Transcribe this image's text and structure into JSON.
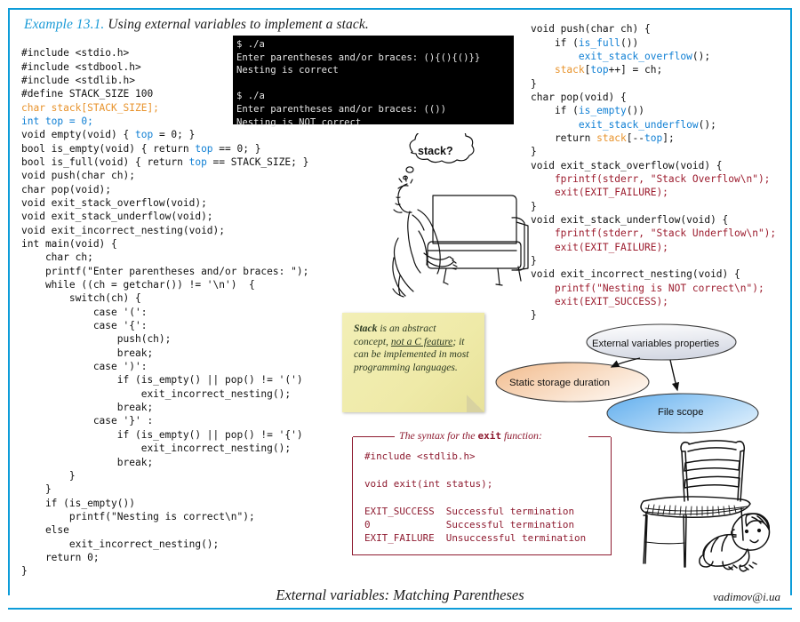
{
  "theme": {
    "frame_color": "#0d9cd9",
    "accent_blue": "#1b9bd7",
    "code_blue": "#0f7fd4",
    "code_orange": "#e8932c",
    "code_red": "#8e1b30",
    "sticky_yellow": "#efeaa8",
    "terminal_bg": "#000000",
    "terminal_fg": "#e3e3e3"
  },
  "caption": {
    "example_number": "Example 13.1.",
    "text": " Using external variables to implement a stack."
  },
  "code_left": {
    "lines": [
      "#include <stdio.h>",
      "#include <stdbool.h>",
      "#include <stdlib.h>",
      "#define STACK_SIZE 100",
      "char stack[STACK_SIZE];",
      "int top = 0;",
      "void empty(void) { top = 0; }",
      "bool is_empty(void) { return top == 0; }",
      "bool is_full(void) { return top == STACK_SIZE; }",
      "void push(char ch);",
      "char pop(void);",
      "void exit_stack_overflow(void);",
      "void exit_stack_underflow(void);",
      "void exit_incorrect_nesting(void);",
      "int main(void) {",
      "    char ch;",
      "    printf(\"Enter parentheses and/or braces: \");",
      "    while ((ch = getchar()) != '\\n')  {",
      "        switch(ch) {",
      "            case '(':",
      "            case '{':",
      "                push(ch);",
      "                break;",
      "            case ')':",
      "                if (is_empty() || pop() != '(')",
      "                    exit_incorrect_nesting();",
      "                break;",
      "            case '}' :",
      "                if (is_empty() || pop() != '{')",
      "                    exit_incorrect_nesting();",
      "                break;",
      "        }",
      "    }",
      "    if (is_empty())",
      "        printf(\"Nesting is correct\\n\");",
      "    else",
      "        exit_incorrect_nesting();",
      "    return 0;",
      "}"
    ]
  },
  "code_right": {
    "lines": [
      "void push(char ch) {",
      "    if (is_full())",
      "        exit_stack_overflow();",
      "    stack[top++] = ch;",
      "}",
      "char pop(void) {",
      "    if (is_empty())",
      "        exit_stack_underflow();",
      "    return stack[--top];",
      "}",
      "void exit_stack_overflow(void) {",
      "    fprintf(stderr, \"Stack Overflow\\n\");",
      "    exit(EXIT_FAILURE);",
      "}",
      "void exit_stack_underflow(void) {",
      "    fprintf(stderr, \"Stack Underflow\\n\");",
      "    exit(EXIT_FAILURE);",
      "}",
      "void exit_incorrect_nesting(void) {",
      "    printf(\"Nesting is NOT correct\\n\");",
      "    exit(EXIT_SUCCESS);",
      "}"
    ]
  },
  "terminal": {
    "lines": [
      "$ ./a",
      "Enter parentheses and/or braces: (){(){()}}",
      "Nesting is correct",
      "",
      "$ ./a",
      "Enter parentheses and/or braces: (())",
      "Nesting is NOT correct"
    ],
    "run_command": "$ ./a",
    "prompt_text": "Enter parentheses and/or braces: ",
    "input_ok": "(){(){()}}",
    "output_ok": "Nesting is correct",
    "input_bad": "(())",
    "output_bad": "Nesting is NOT correct"
  },
  "thought_bubble": {
    "text": "stack?"
  },
  "sticky_note": {
    "bold_word": "Stack",
    "part1": " is an abstract concept, ",
    "underlined": "not a C feature",
    "part2": "; it can be implemented in most programming languages."
  },
  "diagram": {
    "nodes": [
      {
        "id": "external-variables-properties",
        "label": "External variables properties",
        "fill_start": "#ffffff",
        "fill_end": "#d9dce6"
      },
      {
        "id": "static-storage-duration",
        "label": "Static storage duration",
        "fill_start": "#f5c396",
        "fill_end": "#fdf0e4"
      },
      {
        "id": "file-scope",
        "label": "File scope",
        "fill_start": "#6fb6ef",
        "fill_end": "#d7ebfb"
      }
    ],
    "edges": [
      {
        "from": "external-variables-properties",
        "to": "static-storage-duration"
      },
      {
        "from": "external-variables-properties",
        "to": "file-scope"
      }
    ]
  },
  "syntax_box": {
    "title_prefix": "The syntax for the ",
    "title_code": "exit",
    "title_suffix": " function:",
    "body": "#include <stdlib.h>\n\nvoid exit(int status);\n\nEXIT_SUCCESS  Successful termination\n0             Successful termination\nEXIT_FAILURE  Unsuccessful termination"
  },
  "footer": {
    "title": "External variables: Matching Parentheses",
    "email": "vadimov@i.ua"
  }
}
